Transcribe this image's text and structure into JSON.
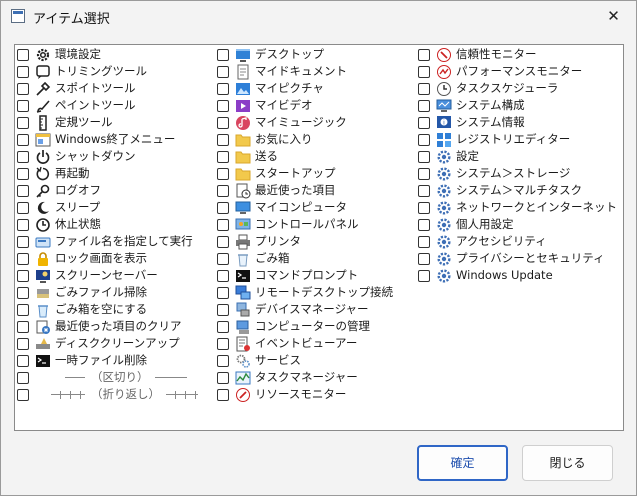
{
  "window": {
    "title": "アイテム選択",
    "close_glyph": "✕"
  },
  "columns": [
    [
      {
        "label": "環境設定",
        "icon": "gear-icon"
      },
      {
        "label": "トリミングツール",
        "icon": "snip-icon"
      },
      {
        "label": "スポイトツール",
        "icon": "eyedropper-icon"
      },
      {
        "label": "ペイントツール",
        "icon": "brush-icon"
      },
      {
        "label": "定規ツール",
        "icon": "ruler-icon"
      },
      {
        "label": "Windows終了メニュー",
        "icon": "menu-icon"
      },
      {
        "label": "シャットダウン",
        "icon": "power-icon"
      },
      {
        "label": "再起動",
        "icon": "restart-icon"
      },
      {
        "label": "ログオフ",
        "icon": "key-icon"
      },
      {
        "label": "スリープ",
        "icon": "moon-icon"
      },
      {
        "label": "休止状態",
        "icon": "clock-icon"
      },
      {
        "label": "ファイル名を指定して実行",
        "icon": "run-icon"
      },
      {
        "label": "ロック画面を表示",
        "icon": "lock-icon"
      },
      {
        "label": "スクリーンセーバー",
        "icon": "screensaver-icon"
      },
      {
        "label": "ごみファイル掃除",
        "icon": "cleanup-icon"
      },
      {
        "label": "ごみ箱を空にする",
        "icon": "recycle-icon"
      },
      {
        "label": "最近使った項目のクリア",
        "icon": "recent-clear-icon"
      },
      {
        "label": "ディスククリーンアップ",
        "icon": "disk-cleanup-icon"
      },
      {
        "label": "一時ファイル削除",
        "icon": "cmd-icon"
      },
      {
        "label": "（区切り）",
        "icon": "separator-line",
        "sep": "line"
      },
      {
        "label": "（折り返し）",
        "icon": "wrap-line",
        "sep": "wrap"
      }
    ],
    [
      {
        "label": "デスクトップ",
        "icon": "desktop-icon"
      },
      {
        "label": "マイドキュメント",
        "icon": "document-icon"
      },
      {
        "label": "マイピクチャ",
        "icon": "pictures-icon"
      },
      {
        "label": "マイビデオ",
        "icon": "video-icon"
      },
      {
        "label": "マイミュージック",
        "icon": "music-icon"
      },
      {
        "label": "お気に入り",
        "icon": "folder-icon"
      },
      {
        "label": "送る",
        "icon": "folder-icon"
      },
      {
        "label": "スタートアップ",
        "icon": "folder-icon"
      },
      {
        "label": "最近使った項目",
        "icon": "recent-icon"
      },
      {
        "label": "マイコンピュータ",
        "icon": "computer-icon"
      },
      {
        "label": "コントロールパネル",
        "icon": "control-panel-icon"
      },
      {
        "label": "プリンタ",
        "icon": "printer-icon"
      },
      {
        "label": "ごみ箱",
        "icon": "recycle-bin-icon"
      },
      {
        "label": "コマンドプロンプト",
        "icon": "cmd-icon"
      },
      {
        "label": "リモートデスクトップ接続",
        "icon": "remote-desktop-icon"
      },
      {
        "label": "デバイスマネージャー",
        "icon": "device-manager-icon"
      },
      {
        "label": "コンピューターの管理",
        "icon": "computer-management-icon"
      },
      {
        "label": "イベントビューアー",
        "icon": "event-viewer-icon"
      },
      {
        "label": "サービス",
        "icon": "services-icon"
      },
      {
        "label": "タスクマネージャー",
        "icon": "task-manager-icon"
      },
      {
        "label": "リソースモニター",
        "icon": "resource-monitor-icon"
      }
    ],
    [
      {
        "label": "信頼性モニター",
        "icon": "reliability-icon"
      },
      {
        "label": "パフォーマンスモニター",
        "icon": "performance-icon"
      },
      {
        "label": "タスクスケジューラ",
        "icon": "scheduler-icon"
      },
      {
        "label": "システム構成",
        "icon": "system-config-icon"
      },
      {
        "label": "システム情報",
        "icon": "system-info-icon"
      },
      {
        "label": "レジストリエディター",
        "icon": "registry-icon"
      },
      {
        "label": "設定",
        "icon": "settings-gear-icon"
      },
      {
        "label": "システム＞ストレージ",
        "icon": "settings-gear-icon"
      },
      {
        "label": "システム＞マルチタスク",
        "icon": "settings-gear-icon"
      },
      {
        "label": "ネットワークとインターネット",
        "icon": "settings-gear-icon"
      },
      {
        "label": "個人用設定",
        "icon": "settings-gear-icon"
      },
      {
        "label": "アクセシビリティ",
        "icon": "settings-gear-icon"
      },
      {
        "label": "プライバシーとセキュリティ",
        "icon": "settings-gear-icon"
      },
      {
        "label": "Windows Update",
        "icon": "settings-gear-icon"
      }
    ]
  ],
  "buttons": {
    "ok": "確定",
    "close": "閉じる"
  }
}
